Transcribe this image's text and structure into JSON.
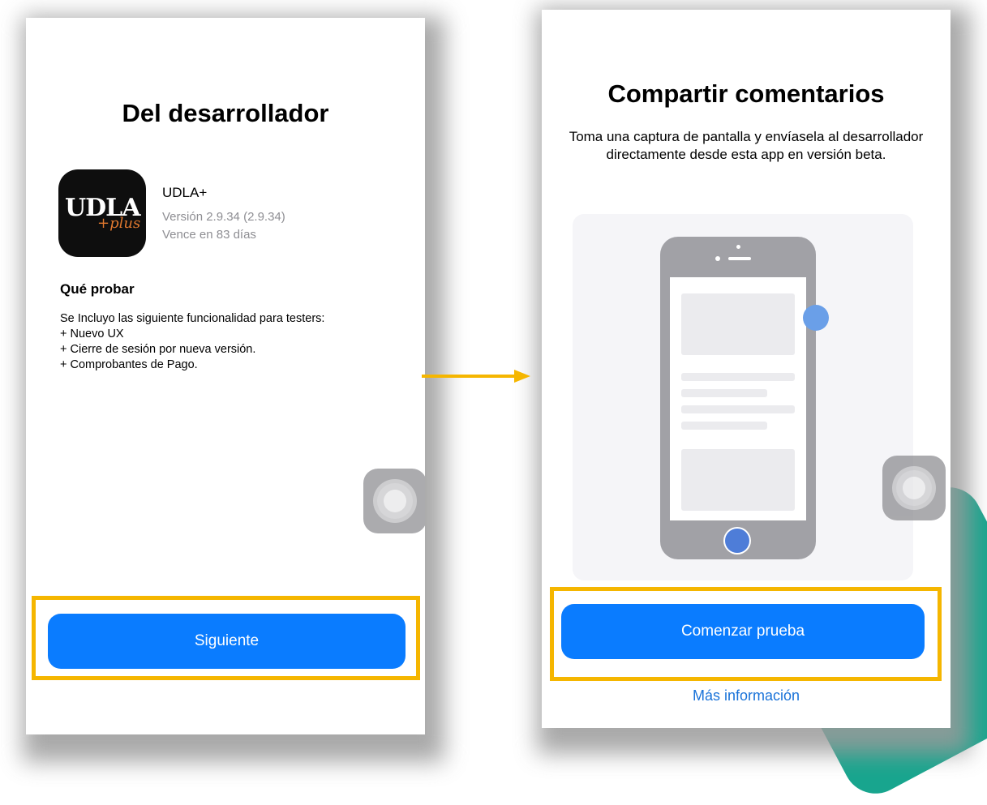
{
  "left_screen": {
    "title": "Del desarrollador",
    "app": {
      "name": "UDLA+",
      "version": "Versión 2.9.34 (2.9.34)",
      "expiry": "Vence en 83 días",
      "logo_text": "UDLA",
      "logo_sub": "+plus"
    },
    "what_to_test": {
      "heading": "Qué probar",
      "intro": "Se Incluyo las siguiente funcionalidad para testers:",
      "items": [
        "+ Nuevo UX",
        "+ Cierre de sesión por nueva versión.",
        "+ Comprobantes de Pago."
      ]
    },
    "primary_button": "Siguiente"
  },
  "right_screen": {
    "title": "Compartir comentarios",
    "description": "Toma una captura de pantalla y envíasela al desarrollador directamente desde esta app en versión beta.",
    "primary_button": "Comenzar prueba",
    "link": "Más información"
  },
  "colors": {
    "accent_blue": "#0a7cff",
    "highlight": "#f5b600",
    "link_blue": "#1a73d9",
    "arrow": "#f5b600",
    "teal": "#18a58e"
  },
  "icons": [
    "arrow-right-icon",
    "assistive-touch-icon",
    "phone-illustration"
  ]
}
